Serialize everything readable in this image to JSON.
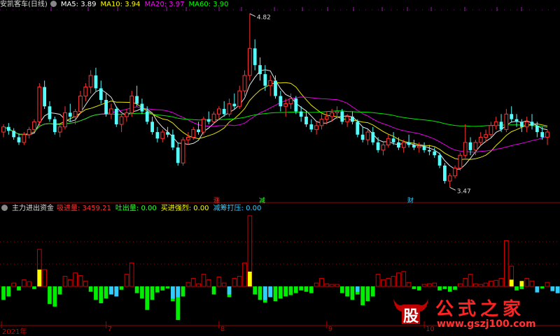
{
  "header": {
    "stock": "安凯客车(日线)",
    "ma": [
      {
        "label": "MA5:",
        "value": "3.89",
        "color": "#ffffff"
      },
      {
        "label": "MA10:",
        "value": "3.94",
        "color": "#ffff00"
      },
      {
        "label": "MA20:",
        "value": "3.97",
        "color": "#ff00ff"
      },
      {
        "label": "MA60:",
        "value": "3.90",
        "color": "#00ff00"
      }
    ]
  },
  "indicator": {
    "name": "主力进出资金",
    "items": [
      {
        "label": "吸进量:",
        "value": "3459.21",
        "color": "#ff3333"
      },
      {
        "label": "吐出量:",
        "value": "0.00",
        "color": "#33ff33"
      },
      {
        "label": "买进强烈:",
        "value": "0.00",
        "color": "#ffff00"
      },
      {
        "label": "减筹打压:",
        "value": "0.00",
        "color": "#33ccff"
      }
    ]
  },
  "markers": {
    "rise": "涨",
    "reduce": "减",
    "fortune": "财"
  },
  "watermark": {
    "logo": "股",
    "name": "公式之家",
    "url": "www.gszj100.com"
  },
  "chart_data": [
    {
      "type": "candlestick",
      "price_range": [
        3.45,
        4.85
      ],
      "annotations": {
        "high": "4.82",
        "low": "3.47"
      },
      "ohlc": [
        [
          3.9,
          3.96,
          3.86,
          3.94
        ],
        [
          3.94,
          3.97,
          3.88,
          3.91
        ],
        [
          3.91,
          3.93,
          3.84,
          3.86
        ],
        [
          3.86,
          3.89,
          3.8,
          3.82
        ],
        [
          3.82,
          3.9,
          3.8,
          3.88
        ],
        [
          3.88,
          3.94,
          3.85,
          3.92
        ],
        [
          3.92,
          4.0,
          3.9,
          3.98
        ],
        [
          3.98,
          4.28,
          3.95,
          4.25
        ],
        [
          4.25,
          4.3,
          4.08,
          4.1
        ],
        [
          4.1,
          4.14,
          3.98,
          4.0
        ],
        [
          4.0,
          4.02,
          3.88,
          3.9
        ],
        [
          3.9,
          3.96,
          3.86,
          3.94
        ],
        [
          3.94,
          4.1,
          3.92,
          4.05
        ],
        [
          4.05,
          4.12,
          3.98,
          4.02
        ],
        [
          4.02,
          4.08,
          3.96,
          4.06
        ],
        [
          4.06,
          4.22,
          4.04,
          4.18
        ],
        [
          4.18,
          4.28,
          4.14,
          4.25
        ],
        [
          4.25,
          4.38,
          4.2,
          4.34
        ],
        [
          4.34,
          4.4,
          4.22,
          4.24
        ],
        [
          4.24,
          4.3,
          4.12,
          4.15
        ],
        [
          4.15,
          4.2,
          4.02,
          4.04
        ],
        [
          4.04,
          4.12,
          4.0,
          4.08
        ],
        [
          4.08,
          4.1,
          3.94,
          3.96
        ],
        [
          3.96,
          4.04,
          3.9,
          4.02
        ],
        [
          4.02,
          4.08,
          3.98,
          4.05
        ],
        [
          4.05,
          4.22,
          4.02,
          4.18
        ],
        [
          4.18,
          4.26,
          4.1,
          4.12
        ],
        [
          4.12,
          4.16,
          4.04,
          4.06
        ],
        [
          4.06,
          4.1,
          3.96,
          3.98
        ],
        [
          3.98,
          4.02,
          3.88,
          3.9
        ],
        [
          3.9,
          3.94,
          3.82,
          3.85
        ],
        [
          3.85,
          3.92,
          3.82,
          3.9
        ],
        [
          3.9,
          3.94,
          3.86,
          3.88
        ],
        [
          3.88,
          3.92,
          3.76,
          3.78
        ],
        [
          3.78,
          3.82,
          3.64,
          3.66
        ],
        [
          3.66,
          3.86,
          3.64,
          3.84
        ],
        [
          3.84,
          3.9,
          3.8,
          3.86
        ],
        [
          3.86,
          3.94,
          3.84,
          3.92
        ],
        [
          3.92,
          3.98,
          3.88,
          3.9
        ],
        [
          3.9,
          4.02,
          3.88,
          4.0
        ],
        [
          4.0,
          4.06,
          3.96,
          3.98
        ],
        [
          3.98,
          4.06,
          3.96,
          4.04
        ],
        [
          4.04,
          4.1,
          4.0,
          4.08
        ],
        [
          4.08,
          4.14,
          4.02,
          4.04
        ],
        [
          4.04,
          4.16,
          4.02,
          4.12
        ],
        [
          4.12,
          4.2,
          4.08,
          4.1
        ],
        [
          4.1,
          4.26,
          4.08,
          4.22
        ],
        [
          4.22,
          4.38,
          4.18,
          4.34
        ],
        [
          4.34,
          4.82,
          4.3,
          4.55
        ],
        [
          4.55,
          4.62,
          4.38,
          4.42
        ],
        [
          4.42,
          4.48,
          4.3,
          4.35
        ],
        [
          4.35,
          4.42,
          4.22,
          4.26
        ],
        [
          4.26,
          4.34,
          4.18,
          4.3
        ],
        [
          4.3,
          4.34,
          4.16,
          4.18
        ],
        [
          4.18,
          4.22,
          4.06,
          4.1
        ],
        [
          4.1,
          4.16,
          4.02,
          4.12
        ],
        [
          4.12,
          4.2,
          4.08,
          4.16
        ],
        [
          4.16,
          4.18,
          4.04,
          4.06
        ],
        [
          4.06,
          4.1,
          3.98,
          4.02
        ],
        [
          4.02,
          4.06,
          3.94,
          3.96
        ],
        [
          3.96,
          4.0,
          3.9,
          3.92
        ],
        [
          3.92,
          3.98,
          3.88,
          3.95
        ],
        [
          3.95,
          4.04,
          3.92,
          4.0
        ],
        [
          4.0,
          4.06,
          3.96,
          4.02
        ],
        [
          4.02,
          4.08,
          3.98,
          4.05
        ],
        [
          4.05,
          4.1,
          4.0,
          4.06
        ],
        [
          4.06,
          4.08,
          3.96,
          3.98
        ],
        [
          3.98,
          4.04,
          3.94,
          4.02
        ],
        [
          4.02,
          4.06,
          3.96,
          3.98
        ],
        [
          3.98,
          4.0,
          3.86,
          3.88
        ],
        [
          3.88,
          3.94,
          3.82,
          3.84
        ],
        [
          3.84,
          3.92,
          3.8,
          3.9
        ],
        [
          3.9,
          3.94,
          3.8,
          3.82
        ],
        [
          3.82,
          3.86,
          3.74,
          3.76
        ],
        [
          3.76,
          3.82,
          3.72,
          3.8
        ],
        [
          3.8,
          3.88,
          3.78,
          3.85
        ],
        [
          3.85,
          3.9,
          3.8,
          3.82
        ],
        [
          3.82,
          3.86,
          3.76,
          3.78
        ],
        [
          3.78,
          3.84,
          3.74,
          3.82
        ],
        [
          3.82,
          3.88,
          3.78,
          3.8
        ],
        [
          3.8,
          3.84,
          3.76,
          3.78
        ],
        [
          3.78,
          3.82,
          3.74,
          3.79
        ],
        [
          3.79,
          3.82,
          3.74,
          3.76
        ],
        [
          3.76,
          3.8,
          3.72,
          3.75
        ],
        [
          3.75,
          3.78,
          3.7,
          3.72
        ],
        [
          3.72,
          3.74,
          3.62,
          3.64
        ],
        [
          3.64,
          3.66,
          3.5,
          3.52
        ],
        [
          3.52,
          3.58,
          3.47,
          3.56
        ],
        [
          3.56,
          3.64,
          3.54,
          3.62
        ],
        [
          3.62,
          3.74,
          3.6,
          3.72
        ],
        [
          3.72,
          3.96,
          3.7,
          3.82
        ],
        [
          3.82,
          3.86,
          3.72,
          3.76
        ],
        [
          3.76,
          3.84,
          3.72,
          3.82
        ],
        [
          3.82,
          3.9,
          3.8,
          3.86
        ],
        [
          3.86,
          3.92,
          3.82,
          3.88
        ],
        [
          3.88,
          3.98,
          3.86,
          3.95
        ],
        [
          3.95,
          4.02,
          3.92,
          3.98
        ],
        [
          3.98,
          4.04,
          3.9,
          3.92
        ],
        [
          3.92,
          4.08,
          3.9,
          4.04
        ],
        [
          4.04,
          4.1,
          3.98,
          4.0
        ],
        [
          4.0,
          4.04,
          3.94,
          3.98
        ],
        [
          3.98,
          4.0,
          3.9,
          3.94
        ],
        [
          3.94,
          4.02,
          3.9,
          3.98
        ],
        [
          3.98,
          4.04,
          3.92,
          3.95
        ],
        [
          3.95,
          3.98,
          3.86,
          3.9
        ],
        [
          3.9,
          3.94,
          3.84,
          3.86
        ],
        [
          3.86,
          3.92,
          3.8,
          3.9
        ]
      ]
    },
    {
      "type": "bar",
      "series_colors": {
        "inflow": "#cc0000",
        "outflow": "#00ee00",
        "strong_buy": "#ffff00",
        "suppress": "#33ccff"
      },
      "values": [
        -2.0,
        -1.5,
        0.5,
        -0.6,
        1.0,
        0.7,
        -0.4,
        5.5,
        2.5,
        -2.6,
        -3.0,
        -1.2,
        1.5,
        1.0,
        2.0,
        1.6,
        0.8,
        -0.8,
        -2.0,
        -2.5,
        -1.8,
        -1.2,
        -0.8,
        -0.5,
        1.8,
        3.5,
        -1.0,
        -1.8,
        -3.5,
        -2.0,
        -0.9,
        -0.6,
        -0.3,
        -2.2,
        -5.0,
        -1.5,
        0.6,
        1.2,
        0.4,
        1.8,
        1.0,
        -1.2,
        1.4,
        0.5,
        -1.6,
        1.2,
        1.5,
        3.5,
        10.5,
        -1.2,
        -2.0,
        -2.4,
        -1.5,
        -2.2,
        -1.8,
        -1.5,
        -1.3,
        -1.0,
        -0.6,
        -0.8,
        -1.0,
        0.5,
        1.2,
        0.4,
        0.3,
        0.3,
        -1.0,
        -1.5,
        -2.0,
        -1.2,
        -2.8,
        -2.2,
        -1.5,
        1.8,
        1.0,
        1.2,
        1.5,
        2.0,
        2.2,
        0.6,
        -0.4,
        -0.6,
        0.3,
        0.4,
        0.5,
        -0.6,
        -0.4,
        -0.8,
        -0.5,
        0.4,
        1.2,
        1.8,
        0.4,
        0.3,
        0.5,
        0.8,
        0.9,
        1.2,
        6.8,
        3.0,
        -0.6,
        -0.4,
        1.2,
        0.8,
        -0.5,
        -0.3,
        0.6,
        -0.4,
        -1.0,
        -1.2,
        -0.6
      ],
      "strong_buy": [
        [
          7,
          2.5
        ],
        [
          48,
          2.2
        ],
        [
          99,
          1.0
        ],
        [
          101,
          0.8
        ]
      ],
      "suppress": [
        [
          21,
          1.2
        ],
        [
          22,
          1.5
        ],
        [
          33,
          1.8
        ],
        [
          34,
          1.6
        ],
        [
          44,
          1.2
        ],
        [
          51,
          2.0
        ],
        [
          52,
          1.6
        ],
        [
          69,
          0.8
        ],
        [
          104,
          0.9
        ],
        [
          107,
          0.7
        ],
        [
          108,
          1.0
        ]
      ],
      "bar_range": [
        -5.5,
        10.8
      ]
    }
  ],
  "x_axis": {
    "labels": [
      {
        "text": "2021年",
        "index": 0
      },
      {
        "text": "7",
        "index": 20
      },
      {
        "text": "8",
        "index": 42
      },
      {
        "text": "9",
        "index": 63
      },
      {
        "text": "10",
        "index": 82
      }
    ]
  }
}
